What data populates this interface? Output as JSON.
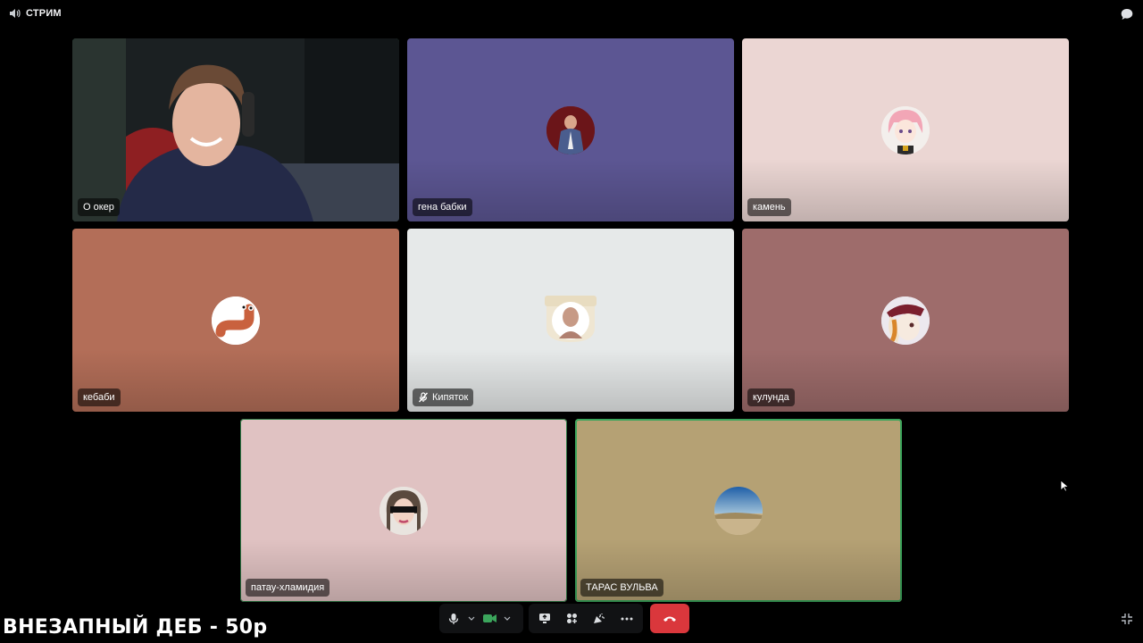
{
  "channel": {
    "name": "СТРИМ",
    "icon": "speaker-icon"
  },
  "participants": [
    {
      "name": "О окер",
      "bg": "#1d2224",
      "type": "video",
      "speaking": true
    },
    {
      "name": "гена бабки",
      "bg": "#5c5693",
      "type": "avatar"
    },
    {
      "name": "камень",
      "bg": "#ebd6d3",
      "type": "avatar"
    },
    {
      "name": "кебаби",
      "bg": "#b36e58",
      "type": "avatar"
    },
    {
      "name": "Кипяток",
      "bg": "#e6e9e9",
      "type": "avatar",
      "status_icon": "mic-muted-icon"
    },
    {
      "name": "кулунда",
      "bg": "#9e6c6b",
      "type": "avatar"
    },
    {
      "name": "патау-хламидия",
      "bg": "#e0c2c2",
      "type": "avatar"
    },
    {
      "name": "ТАРАС ВУЛЬВА",
      "bg": "#b5a174",
      "type": "avatar",
      "speaking": true
    }
  ],
  "controls": {
    "hangup_color": "#da373c",
    "accent": "#3ba55c",
    "buttons": [
      "mic-icon",
      "camera-icon",
      "screen-share-icon",
      "activities-icon",
      "soundboard-icon",
      "more-icon",
      "hangup-icon"
    ]
  },
  "overlay": {
    "text": "ВНЕЗАПНЫЙ ДЕБ - 50р"
  }
}
